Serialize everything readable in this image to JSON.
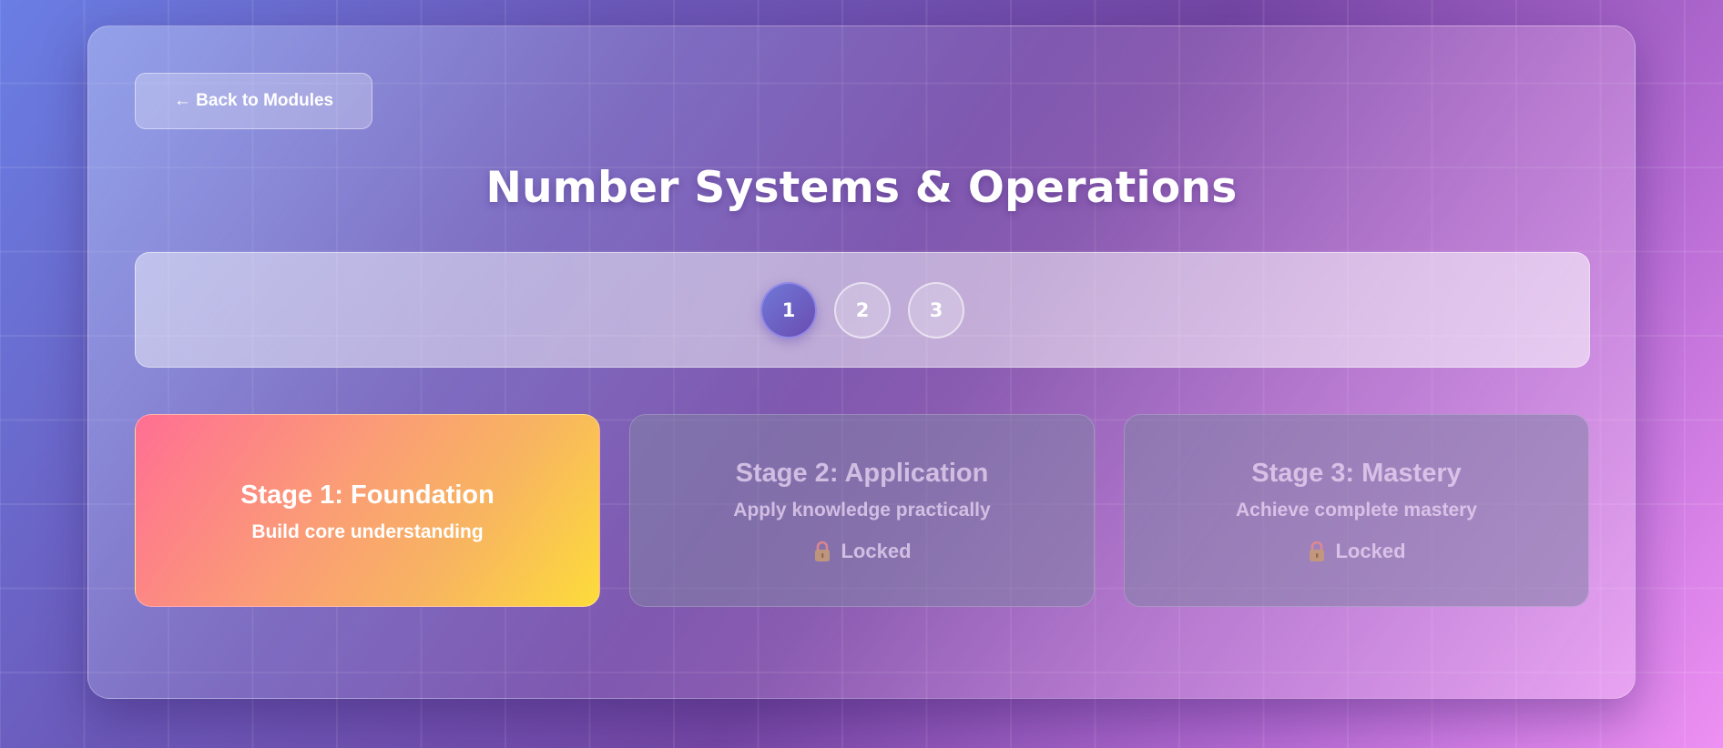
{
  "nav": {
    "back_label": "← Back to Modules"
  },
  "page": {
    "title": "Number Systems & Operations"
  },
  "stepper": {
    "steps": [
      {
        "label": "1",
        "state": "active"
      },
      {
        "label": "2",
        "state": "inactive"
      },
      {
        "label": "3",
        "state": "inactive"
      }
    ]
  },
  "stages": [
    {
      "title": "Stage 1: Foundation",
      "subtitle": "Build core understanding",
      "locked": false
    },
    {
      "title": "Stage 2: Application",
      "subtitle": "Apply knowledge practically",
      "locked": true,
      "status": "Locked",
      "icon": "lock-icon"
    },
    {
      "title": "Stage 3: Mastery",
      "subtitle": "Achieve complete mastery",
      "locked": true,
      "status": "Locked",
      "icon": "lock-icon"
    }
  ],
  "colors": {
    "active_step": "#6a4cb0",
    "stage1_gradient_start": "#ff6f93",
    "stage1_gradient_end": "#fddc3a",
    "lock_body": "#c89b74",
    "lock_shackle": "#e98a8a"
  }
}
